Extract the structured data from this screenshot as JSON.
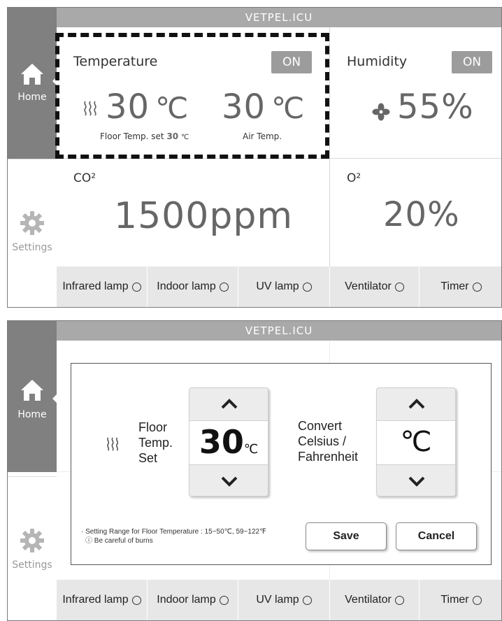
{
  "app": {
    "title": "VETPEL.ICU"
  },
  "sidebar": {
    "home_label": "Home",
    "settings_label": "Settings"
  },
  "cards": {
    "temperature": {
      "title": "Temperature",
      "status": "ON",
      "floor_value": "30",
      "floor_unit": "℃",
      "air_value": "30",
      "air_unit": "℃",
      "floor_caption": "Floor Temp. set",
      "floor_caption_value": "30",
      "floor_caption_unit": "℃",
      "air_caption": "Air Temp."
    },
    "humidity": {
      "title": "Humidity",
      "status": "ON",
      "value": "55%"
    },
    "co2": {
      "title": "CO²",
      "value": "1500ppm"
    },
    "o2": {
      "title": "O²",
      "value": "20%"
    }
  },
  "bottom_bar": [
    "Infrared lamp",
    "Indoor lamp",
    "UV lamp",
    "Ventilator",
    "Timer"
  ],
  "modal": {
    "floor_label_lines": [
      "Floor",
      "Temp.",
      "Set"
    ],
    "floor_value": "30",
    "floor_unit": "℃",
    "convert_label_lines": [
      "Convert",
      "Celsius /",
      "Fahrenheit"
    ],
    "unit_value": "℃",
    "note_line1": "· Setting Range for Floor Temperature : 15~50℃, 59~122℉",
    "note_line2": "ⓘ Be careful of burns",
    "save_label": "Save",
    "cancel_label": "Cancel"
  },
  "icons": [
    "home-icon",
    "gear-icon",
    "heat-wave-icon",
    "fan-icon",
    "chevron-up-icon",
    "chevron-down-icon"
  ]
}
